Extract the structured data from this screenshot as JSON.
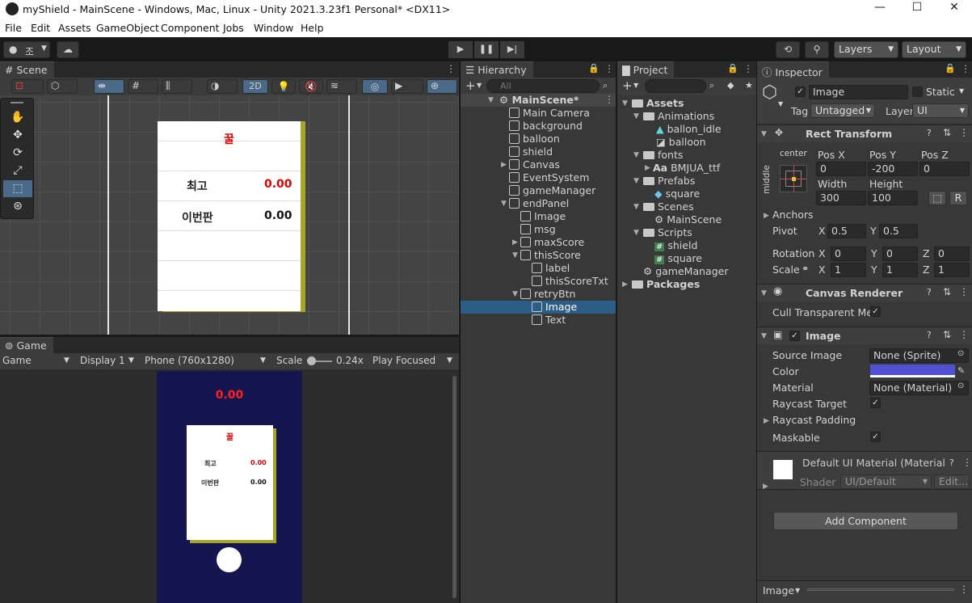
{
  "window": {
    "title": "myShield - MainScene - Windows, Mac, Linux - Unity 2021.3.23f1 Personal* <DX11>",
    "minimize": "—",
    "maximize": "☐",
    "close": "✕"
  },
  "menu": [
    "File",
    "Edit",
    "Assets",
    "GameObject",
    "Component",
    "Jobs",
    "Window",
    "Help"
  ],
  "toolbar": {
    "account": "조",
    "layers": "Layers",
    "layout": "Layout"
  },
  "scene": {
    "tab": "Scene",
    "mode2d": "2D",
    "panel": {
      "title": "꿀",
      "row1_label": "최고",
      "row1_value": "0.00",
      "row2_label": "이번판",
      "row2_value": "0.00"
    }
  },
  "game": {
    "tab": "Game",
    "view": "Game",
    "display": "Display 1",
    "resolution": "Phone (760x1280)",
    "scale_label": "Scale",
    "scale_value": "0.24x",
    "play_focused": "Play Focused",
    "score": "0.00",
    "panel": {
      "title": "꿀",
      "row1_label": "최고",
      "row1_value": "0.00",
      "row2_label": "이번판",
      "row2_value": "0.00"
    }
  },
  "hierarchy": {
    "tab": "Hierarchy",
    "search_placeholder": "All",
    "items": [
      "MainScene*",
      "Main Camera",
      "background",
      "balloon",
      "shield",
      "Canvas",
      "EventSystem",
      "gameManager",
      "endPanel",
      "Image",
      "msg",
      "maxScore",
      "thisScore",
      "label",
      "thisScoreTxt",
      "retryBtn",
      "Image",
      "Text"
    ]
  },
  "project": {
    "tab": "Project",
    "items": [
      "Assets",
      "Animations",
      "ballon_idle",
      "balloon",
      "fonts",
      "BMJUA_ttf",
      "Prefabs",
      "square",
      "Scenes",
      "MainScene",
      "Scripts",
      "shield",
      "square",
      "gameManager",
      "Packages"
    ],
    "font_prefix": "Aa"
  },
  "inspector": {
    "tab": "Inspector",
    "name": "Image",
    "static": "Static",
    "tag_label": "Tag",
    "tag": "Untagged",
    "layer_label": "Layer",
    "layer": "UI",
    "rect": {
      "title": "Rect Transform",
      "anchor_h": "center",
      "anchor_v": "middle",
      "posx_l": "Pos X",
      "posy_l": "Pos Y",
      "posz_l": "Pos Z",
      "posx": "0",
      "posy": "-200",
      "posz": "0",
      "width_l": "Width",
      "height_l": "Height",
      "width": "300",
      "height": "100",
      "r_btn": "R",
      "anchors": "Anchors",
      "pivot": "Pivot",
      "pivot_x": "0.5",
      "pivot_y": "0.5",
      "rotation": "Rotation",
      "rot_x": "0",
      "rot_y": "0",
      "rot_z": "0",
      "scale": "Scale",
      "sc_x": "1",
      "sc_y": "1",
      "sc_z": "1",
      "x": "X",
      "y": "Y",
      "z": "Z"
    },
    "canvas_renderer": {
      "title": "Canvas Renderer",
      "cull": "Cull Transparent Mes"
    },
    "image": {
      "title": "Image",
      "source_l": "Source Image",
      "source": "None (Sprite)",
      "color_l": "Color",
      "color": "#5151d4",
      "material_l": "Material",
      "material": "None (Material)",
      "raycast_target": "Raycast Target",
      "raycast_padding": "Raycast Padding",
      "maskable": "Maskable"
    },
    "material": {
      "title": "Default UI Material (Material",
      "shader_l": "Shader",
      "shader": "UI/Default",
      "edit": "Edit..."
    },
    "add_component": "Add Component",
    "footer": "Image"
  }
}
